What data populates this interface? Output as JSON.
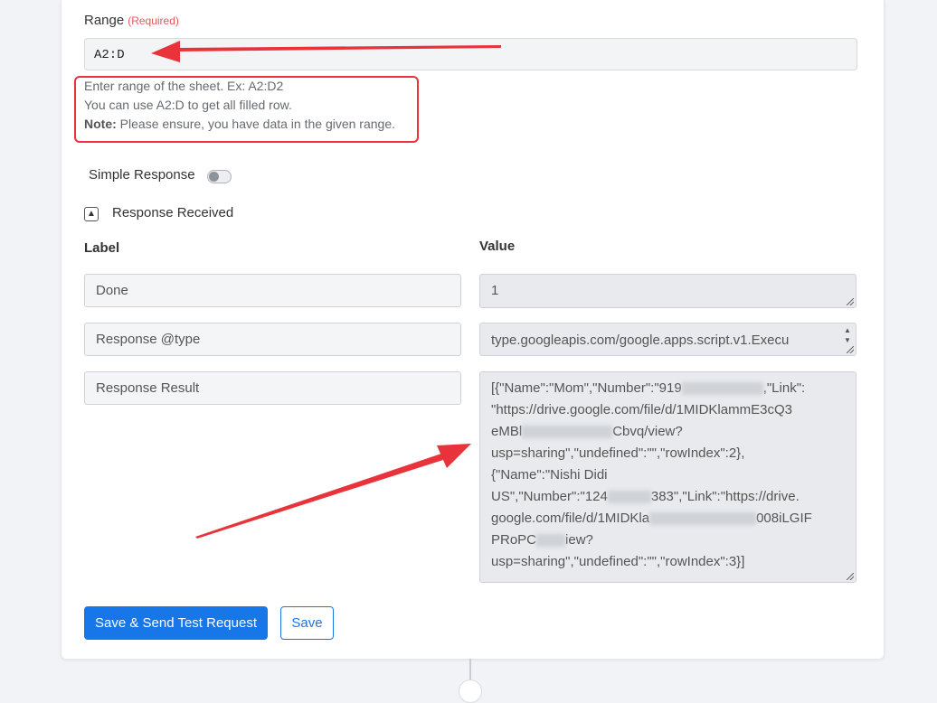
{
  "range": {
    "label": "Range",
    "required": "(Required)",
    "value": "A2:D"
  },
  "hint": {
    "line1": "Enter range of the sheet. Ex: A2:D2",
    "line2": "You can use A2:D to get all filled row.",
    "note_label": "Note:",
    "note_text": " Please ensure, you have data in the given range."
  },
  "simple_response": {
    "label": "Simple Response",
    "enabled": false
  },
  "response_received": {
    "label": "Response Received",
    "toggle_icon": "chevron-up-icon"
  },
  "table": {
    "label_header": "Label",
    "value_header": "Value",
    "rows": [
      {
        "label": "Done",
        "value": "1"
      },
      {
        "label": "Response @type",
        "value": "type.googleapis.com/google.apps.script.v1.Execu"
      },
      {
        "label": "Response Result",
        "value_lines": [
          "[{\"Name\":\"Mom\",\"Number\":\"919",
          ",\"Link\":",
          "\"https://drive.google.com/file/d/1MIDKlammE3cQ3",
          "eMBl",
          "Cbvq/view?",
          "usp=sharing\",\"undefined\":\"\",\"rowIndex\":2},",
          "{\"Name\":\"Nishi Didi",
          "US\",\"Number\":\"124",
          "383\",\"Link\":\"https://drive.",
          "google.com/file/d/1MIDKla",
          "008iLGIF",
          "PRoPC",
          "iew?",
          "usp=sharing\",\"undefined\":\"\",\"rowIndex\":3}]"
        ]
      }
    ]
  },
  "buttons": {
    "save_send": "Save & Send Test Request",
    "save": "Save"
  },
  "colors": {
    "primary": "#1777e9",
    "annotation": "#e8333a",
    "required": "#e05a5a"
  }
}
